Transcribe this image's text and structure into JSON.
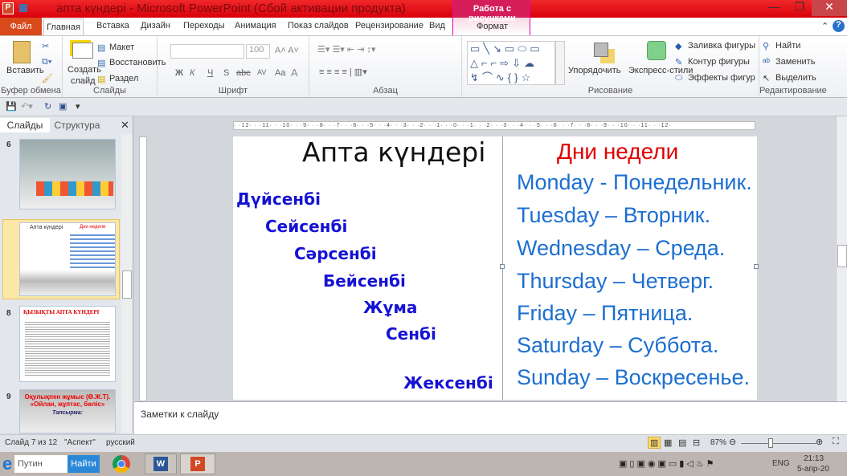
{
  "window": {
    "title": "апта күндері  -  Microsoft PowerPoint (Сбой активации продукта)",
    "context_group": "Работа с рисунками",
    "context_tab": "Формат"
  },
  "tabs": {
    "file": "Файл",
    "items": [
      "Главная",
      "Вставка",
      "Дизайн",
      "Переходы",
      "Анимация",
      "Показ слайдов",
      "Рецензирование",
      "Вид"
    ]
  },
  "ribbon": {
    "clipboard": {
      "label": "Буфер обмена",
      "paste": "Вставить"
    },
    "slides": {
      "label": "Слайды",
      "new_slide_1": "Создать",
      "new_slide_2": "слайд",
      "layout": "Макет",
      "reset": "Восстановить",
      "section": "Раздел"
    },
    "font": {
      "label": "Шрифт",
      "size": "100",
      "bold": "Ж",
      "italic": "К",
      "underline": "Ч",
      "shadow": "S",
      "strike": "abc",
      "spacing": "AV",
      "case": "Aa",
      "color": "A"
    },
    "paragraph": {
      "label": "Абзац"
    },
    "drawing": {
      "label": "Рисование",
      "arrange": "Упорядочить",
      "quick_styles": "Экспресс-стили",
      "fill": "Заливка фигуры",
      "outline": "Контур фигуры",
      "effects": "Эффекты фигур"
    },
    "editing": {
      "label": "Редактирование",
      "find": "Найти",
      "replace": "Заменить",
      "select": "Выделить"
    }
  },
  "slides_pane": {
    "tab_slides": "Слайды",
    "tab_outline": "Структура",
    "thumbs": [
      {
        "num": "6"
      },
      {
        "num": "7",
        "title": "Апта күндері",
        "subtitle": "Дни недели"
      },
      {
        "num": "8",
        "title": "ҚЫЗЫҚТЫ АПТА КҮНДЕРІ"
      },
      {
        "num": "9",
        "title": "Оқулықпен жұмыс (Ө.Ж.Т). «Ойлан, жұптас, бөліс»",
        "subtitle": "Тапсырма:"
      }
    ]
  },
  "ruler": "· ·12· · ·11· · ·10· · ·9· · ·8· · ·7· · ·6· · ·5· · ·4· · ·3· · ·2· · ·1· · ·0· · ·1· · ·2· · ·3· · ·4· · ·5· · ·6· · ·7· · ·8· · ·9· · ·10· · ·11· · ·12·",
  "slide": {
    "title": "Апта күндері",
    "title_ru": "Дни недели",
    "kazakh": [
      "Дүйсенбі",
      "Сейсенбі",
      "Сәрсенбі",
      "Бейсенбі",
      "Жұма",
      "Сенбі",
      "Жексенбі"
    ],
    "english": [
      "Monday - Понедельник.",
      "Tuesday – Вторник.",
      "Wednesday – Среда.",
      "Thursday – Четверг.",
      "Friday – Пятница.",
      "Saturday – Суббота.",
      "Sunday – Воскресенье."
    ]
  },
  "notes": {
    "placeholder": "Заметки к слайду"
  },
  "status": {
    "slide": "Слайд 7 из 12",
    "theme": "\"Аспект\"",
    "language": "русский",
    "zoom": "87%",
    "zoom_value": 87
  },
  "taskbar": {
    "search": "Путин",
    "search_button": "Найти",
    "lang": "ENG",
    "time": "21:13",
    "date": "5-апр-20"
  }
}
